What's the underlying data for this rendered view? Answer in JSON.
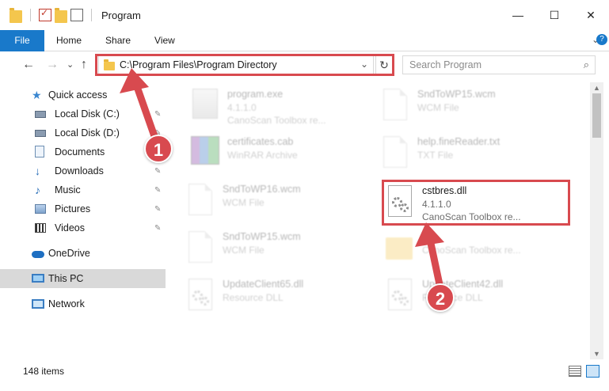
{
  "window": {
    "title": "Program",
    "minimize": "—",
    "maximize": "☐",
    "close": "✕"
  },
  "ribbon": {
    "tabs": [
      "File",
      "Home",
      "Share",
      "View"
    ],
    "expand_icon": "⌄",
    "help_icon": "?"
  },
  "address": {
    "back": "←",
    "forward": "→",
    "recent": "⌄",
    "up": "↑",
    "path": "C:\\Program Files\\Program Directory",
    "dropdown": "⌄",
    "refresh": "↻",
    "search_placeholder": "Search Program",
    "search_icon": "⌕"
  },
  "sidebar": {
    "items": [
      {
        "label": "Quick access",
        "icon": "star-icon",
        "pinned": false
      },
      {
        "label": "Local Disk (C:)",
        "icon": "drive-icon",
        "pinned": true
      },
      {
        "label": "Local Disk (D:)",
        "icon": "drive-icon",
        "pinned": true
      },
      {
        "label": "Documents",
        "icon": "documents-icon",
        "pinned": true
      },
      {
        "label": "Downloads",
        "icon": "download-icon",
        "pinned": true
      },
      {
        "label": "Music",
        "icon": "music-icon",
        "pinned": true
      },
      {
        "label": "Pictures",
        "icon": "pictures-icon",
        "pinned": true
      },
      {
        "label": "Videos",
        "icon": "videos-icon",
        "pinned": true
      },
      {
        "label": "OneDrive",
        "icon": "onedrive-icon",
        "pinned": false
      },
      {
        "label": "This PC",
        "icon": "this-pc-icon",
        "pinned": false,
        "selected": true
      },
      {
        "label": "Network",
        "icon": "network-icon",
        "pinned": false
      }
    ],
    "pin_glyph": "📌"
  },
  "files": [
    {
      "name": "program.exe",
      "line2": "4.1.1.0",
      "line3": "CanoScan Toolbox re...",
      "icon": "exe-icon"
    },
    {
      "name": "SndToWP15.wcm",
      "line2": "WCM File",
      "line3": "",
      "icon": "file-icon"
    },
    {
      "name": "certificates.cab",
      "line2": "WinRAR Archive",
      "line3": "",
      "icon": "winrar-icon"
    },
    {
      "name": "help.fineReader.txt",
      "line2": "TXT File",
      "line3": "",
      "icon": "file-icon"
    },
    {
      "name": "SndToWP16.wcm",
      "line2": "WCM File",
      "line3": "",
      "icon": "file-icon"
    },
    {
      "name": "cstbres.dll",
      "line2": "4.1.1.0",
      "line3": "CanoScan Toolbox re...",
      "icon": "dll-gear-icon"
    },
    {
      "name": "SndToWP15.wcm",
      "line2": "WCM File",
      "line3": "",
      "icon": "file-icon"
    },
    {
      "name": "",
      "line2": "",
      "line3": "CanoScan Toolbox re...",
      "icon": "folder-icon"
    },
    {
      "name": "UpdateClient65.dll",
      "line2": "Resource DLL",
      "line3": "",
      "icon": "dll-gear-icon"
    },
    {
      "name": "UpdateClient42.dll",
      "line2": "Resource DLL",
      "line3": "",
      "icon": "dll-gear-icon"
    }
  ],
  "status": {
    "item_count": "148 items"
  },
  "callouts": [
    "1",
    "2"
  ],
  "colors": {
    "accent": "#1979ca",
    "highlight": "#d84a4f"
  }
}
